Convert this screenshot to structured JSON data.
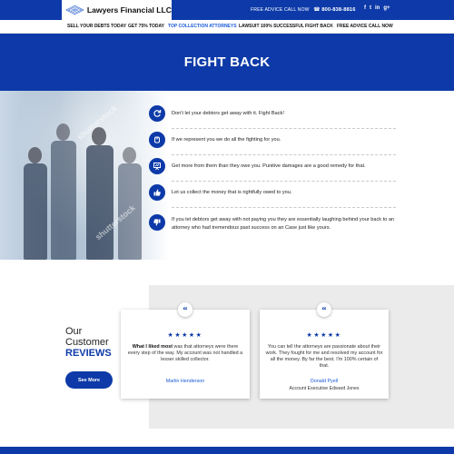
{
  "header": {
    "brand": "Lawyers Financial LLC",
    "advice_label": "FREE ADVICE CALL NOW",
    "phone": "800-838-8816",
    "social": [
      {
        "icon": "facebook-icon",
        "glyph": "f"
      },
      {
        "icon": "twitter-icon",
        "glyph": "t"
      },
      {
        "icon": "linkedin-icon",
        "glyph": "in"
      },
      {
        "icon": "googleplus-icon",
        "glyph": "g+"
      }
    ]
  },
  "nav": {
    "items": [
      {
        "label": "SELL YOUR DEBTS TODAY"
      },
      {
        "label": "GET 75% TODAY"
      },
      {
        "label": "TOP COLLECTION ATTORNEYS",
        "active": true
      },
      {
        "label": "LAWSUIT 100% SUCCESSFUL"
      },
      {
        "label": "FIGHT BACK"
      },
      {
        "label": "FREE ADVICE CALL NOW"
      }
    ]
  },
  "hero": {
    "title": "FIGHT BACK"
  },
  "features": [
    {
      "icon": "refresh-icon",
      "text": "Don't let your debtors get away with it. Fight Back!"
    },
    {
      "icon": "fist-icon",
      "text": "If we represent you we do all the fighting for you."
    },
    {
      "icon": "presentation-icon",
      "text": "Get more from them than they owe you. Punitive damages are a good remedy for that."
    },
    {
      "icon": "thumbs-up-icon",
      "text": "Let us collect the money that is rightfully owed to you."
    },
    {
      "icon": "thumbs-down-icon",
      "text": "If you let debtors get away with not paying you they are essentially laughing behind your back to an attorney who had tremendous past success on an Case just like yours."
    }
  ],
  "reviews": {
    "title_line1": "Our",
    "title_line2": "Customer",
    "title_line3": "REVIEWS",
    "button": "See More",
    "cards": [
      {
        "stars": "★★★★★",
        "bold": "What I liked most",
        "text": " was that attorneys were there every step of the way. My account was not handled a lesser skilled collector.",
        "author": "Marlin Henderson",
        "role": ""
      },
      {
        "stars": "★★★★★",
        "bold": "",
        "text": "You can tell the attorneys are passionate about their work. They fought for me and resolved my account for all the money. By far the best. I'm 100% certain of that.",
        "author": "Donald Pyell",
        "role": "Account Executive Edward Jones"
      }
    ]
  },
  "colors": {
    "primary": "#0d3aa8",
    "accent": "#1a5ad8",
    "panel": "#ebebeb"
  }
}
